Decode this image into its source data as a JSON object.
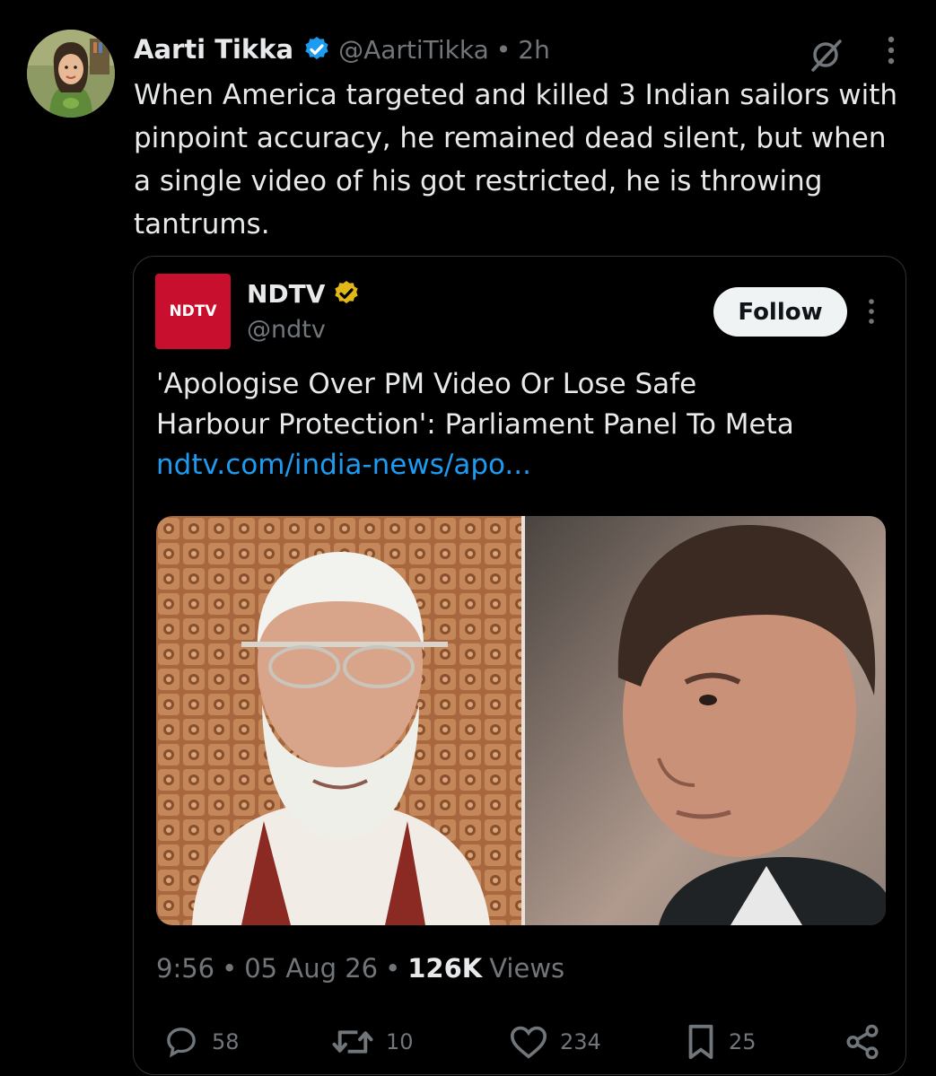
{
  "tweet": {
    "author": {
      "name": "Aarti Tikka",
      "handle": "@AartiTikka",
      "time": "2h",
      "separator": "•"
    },
    "text": "When America targeted and killed 3 Indian sailors with\npinpoint accuracy, he remained dead silent, but when\na single video of his got restricted, he is throwing\ntantrums."
  },
  "quote": {
    "logo_text": "NDTV",
    "name": "NDTV",
    "handle": "@ndtv",
    "follow_label": "Follow",
    "headline": "'Apologise Over PM Video Or Lose Safe\nHarbour Protection': Parliament Panel To Meta",
    "link": "ndtv.com/india-news/apo..."
  },
  "meta": {
    "time": "9:56",
    "date": "05 Aug 26",
    "separator": "•",
    "views_count": "126K",
    "views_label": "Views"
  },
  "actions": {
    "replies": "58",
    "reposts": "10",
    "likes": "234",
    "bookmarks": "25"
  },
  "colors": {
    "background": "#000000",
    "text": "#e7e9ea",
    "muted": "#71767b",
    "link": "#1d9bf0",
    "verified_blue": "#1d9bf0",
    "verified_gold": "#e2b719",
    "ndtv_red": "#c8102e"
  }
}
